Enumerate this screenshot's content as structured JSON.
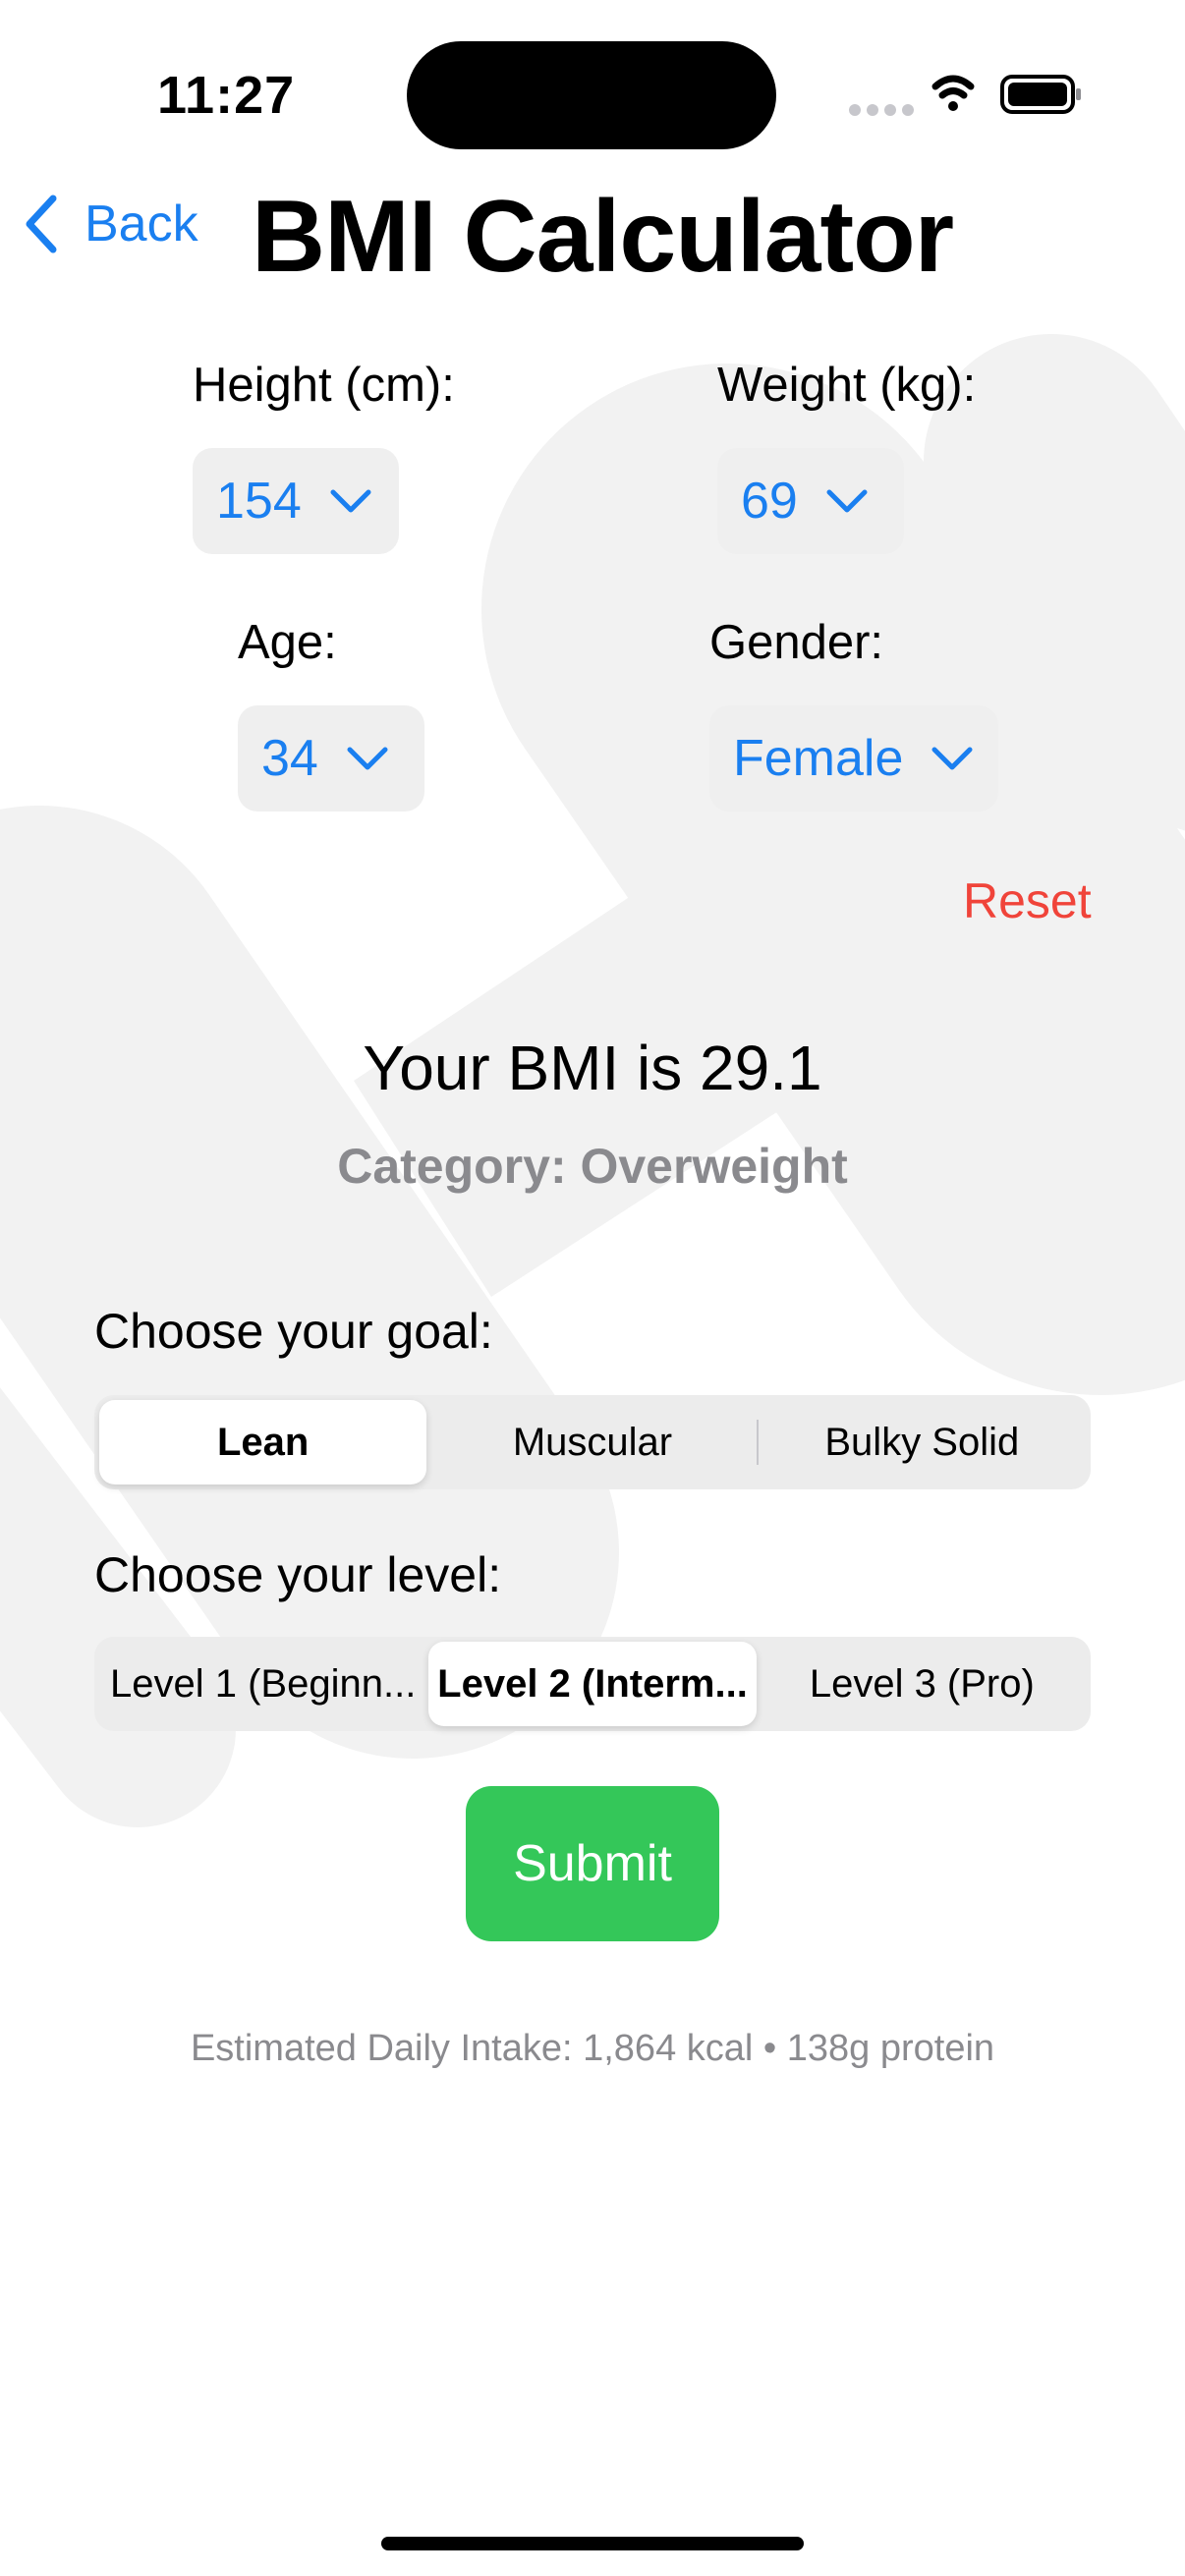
{
  "status_bar": {
    "time": "11:27"
  },
  "nav": {
    "back_label": "Back",
    "title": "BMI Calculator"
  },
  "form": {
    "height": {
      "label": "Height (cm):",
      "value": "154"
    },
    "weight": {
      "label": "Weight (kg):",
      "value": "69"
    },
    "age": {
      "label": "Age:",
      "value": "34"
    },
    "gender": {
      "label": "Gender:",
      "value": "Female"
    },
    "reset_label": "Reset"
  },
  "result": {
    "bmi_text": "Your BMI is 29.1",
    "category_text": "Category: Overweight"
  },
  "goal": {
    "label": "Choose your goal:",
    "options": [
      "Lean",
      "Muscular",
      "Bulky Solid"
    ],
    "selected": "Lean"
  },
  "level": {
    "label": "Choose your level:",
    "options": [
      "Level 1 (Beginn...",
      "Level 2 (Interm...",
      "Level 3 (Pro)"
    ],
    "selected": "Level 2 (Interm..."
  },
  "submit_label": "Submit",
  "intake_text": "Estimated Daily Intake: 1,864 kcal • 138g protein",
  "colors": {
    "accent": "#1a7ff0",
    "destructive": "#f0443a",
    "submit": "#34c759",
    "secondary_text": "#8a8a8e"
  }
}
